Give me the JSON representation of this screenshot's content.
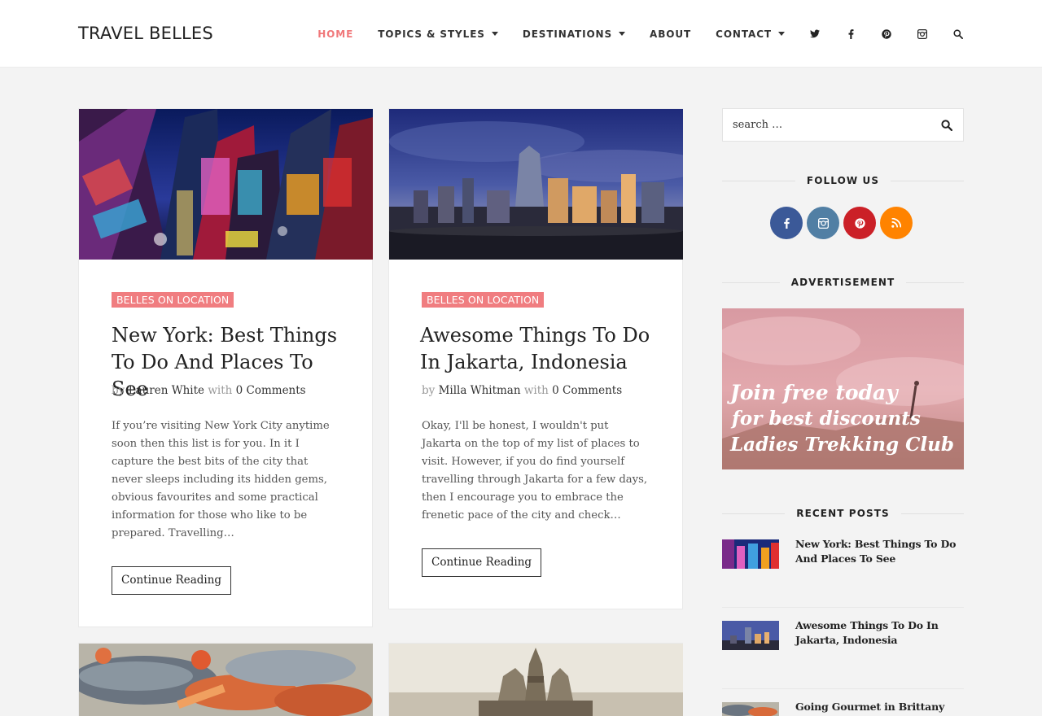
{
  "site": {
    "title": "TRAVEL BELLES"
  },
  "nav": {
    "items": [
      {
        "label": "HOME",
        "active": true,
        "dropdown": false
      },
      {
        "label": "TOPICS & STYLES",
        "active": false,
        "dropdown": true
      },
      {
        "label": "DESTINATIONS",
        "active": false,
        "dropdown": true
      },
      {
        "label": "ABOUT",
        "active": false,
        "dropdown": false
      },
      {
        "label": "CONTACT",
        "active": false,
        "dropdown": true
      }
    ],
    "icons": [
      "twitter-icon",
      "facebook-icon",
      "pinterest-icon",
      "instagram-icon",
      "search-icon"
    ]
  },
  "posts": [
    {
      "category": "BELLES ON LOCATION",
      "title": "New York: Best Things To Do And Places To See",
      "by": "by",
      "author": "Lauren White",
      "with": "with",
      "comments": "0 Comments",
      "excerpt": "If you’re visiting New York City anytime soon then this list is for you. In it I capture the best bits of the city that never sleeps including its hidden gems, obvious favourites and some practical information for those who like to be prepared. Travelling…",
      "readmore": "Continue Reading"
    },
    {
      "category": "BELLES ON LOCATION",
      "title": "Awesome Things To Do In Jakarta, Indonesia",
      "by": "by",
      "author": "Milla Whitman",
      "with": "with",
      "comments": "0 Comments",
      "excerpt": "Okay, I'll be honest, I wouldn't put Jakarta on the top of my list of places to visit. However, if you do find yourself travelling through Jakarta for a few days, then I encourage you to embrace the frenetic pace of the city and check…",
      "readmore": "Continue Reading"
    }
  ],
  "sidebar": {
    "search_placeholder": "search …",
    "follow_title": "FOLLOW US",
    "social": [
      {
        "icon": "facebook-icon",
        "glyph": "f",
        "color": "#3b5998"
      },
      {
        "icon": "instagram-icon",
        "glyph": "◎",
        "color": "#517fa4"
      },
      {
        "icon": "pinterest-icon",
        "glyph": "p",
        "color": "#cb2027"
      },
      {
        "icon": "rss-icon",
        "glyph": "))",
        "color": "#ff8300"
      }
    ],
    "ad_title": "ADVERTISEMENT",
    "ad_text": [
      "Join free today",
      "for best discounts",
      "Ladies Trekking Club"
    ],
    "recent_title": "RECENT POSTS",
    "recent": [
      {
        "title": "New York: Best Things To Do And Places To See"
      },
      {
        "title": "Awesome Things To Do In Jakarta, Indonesia"
      },
      {
        "title": "Going Gourmet in Brittany"
      }
    ]
  },
  "colors": {
    "accent": "#f07d80",
    "background": "#f3f3f3"
  }
}
